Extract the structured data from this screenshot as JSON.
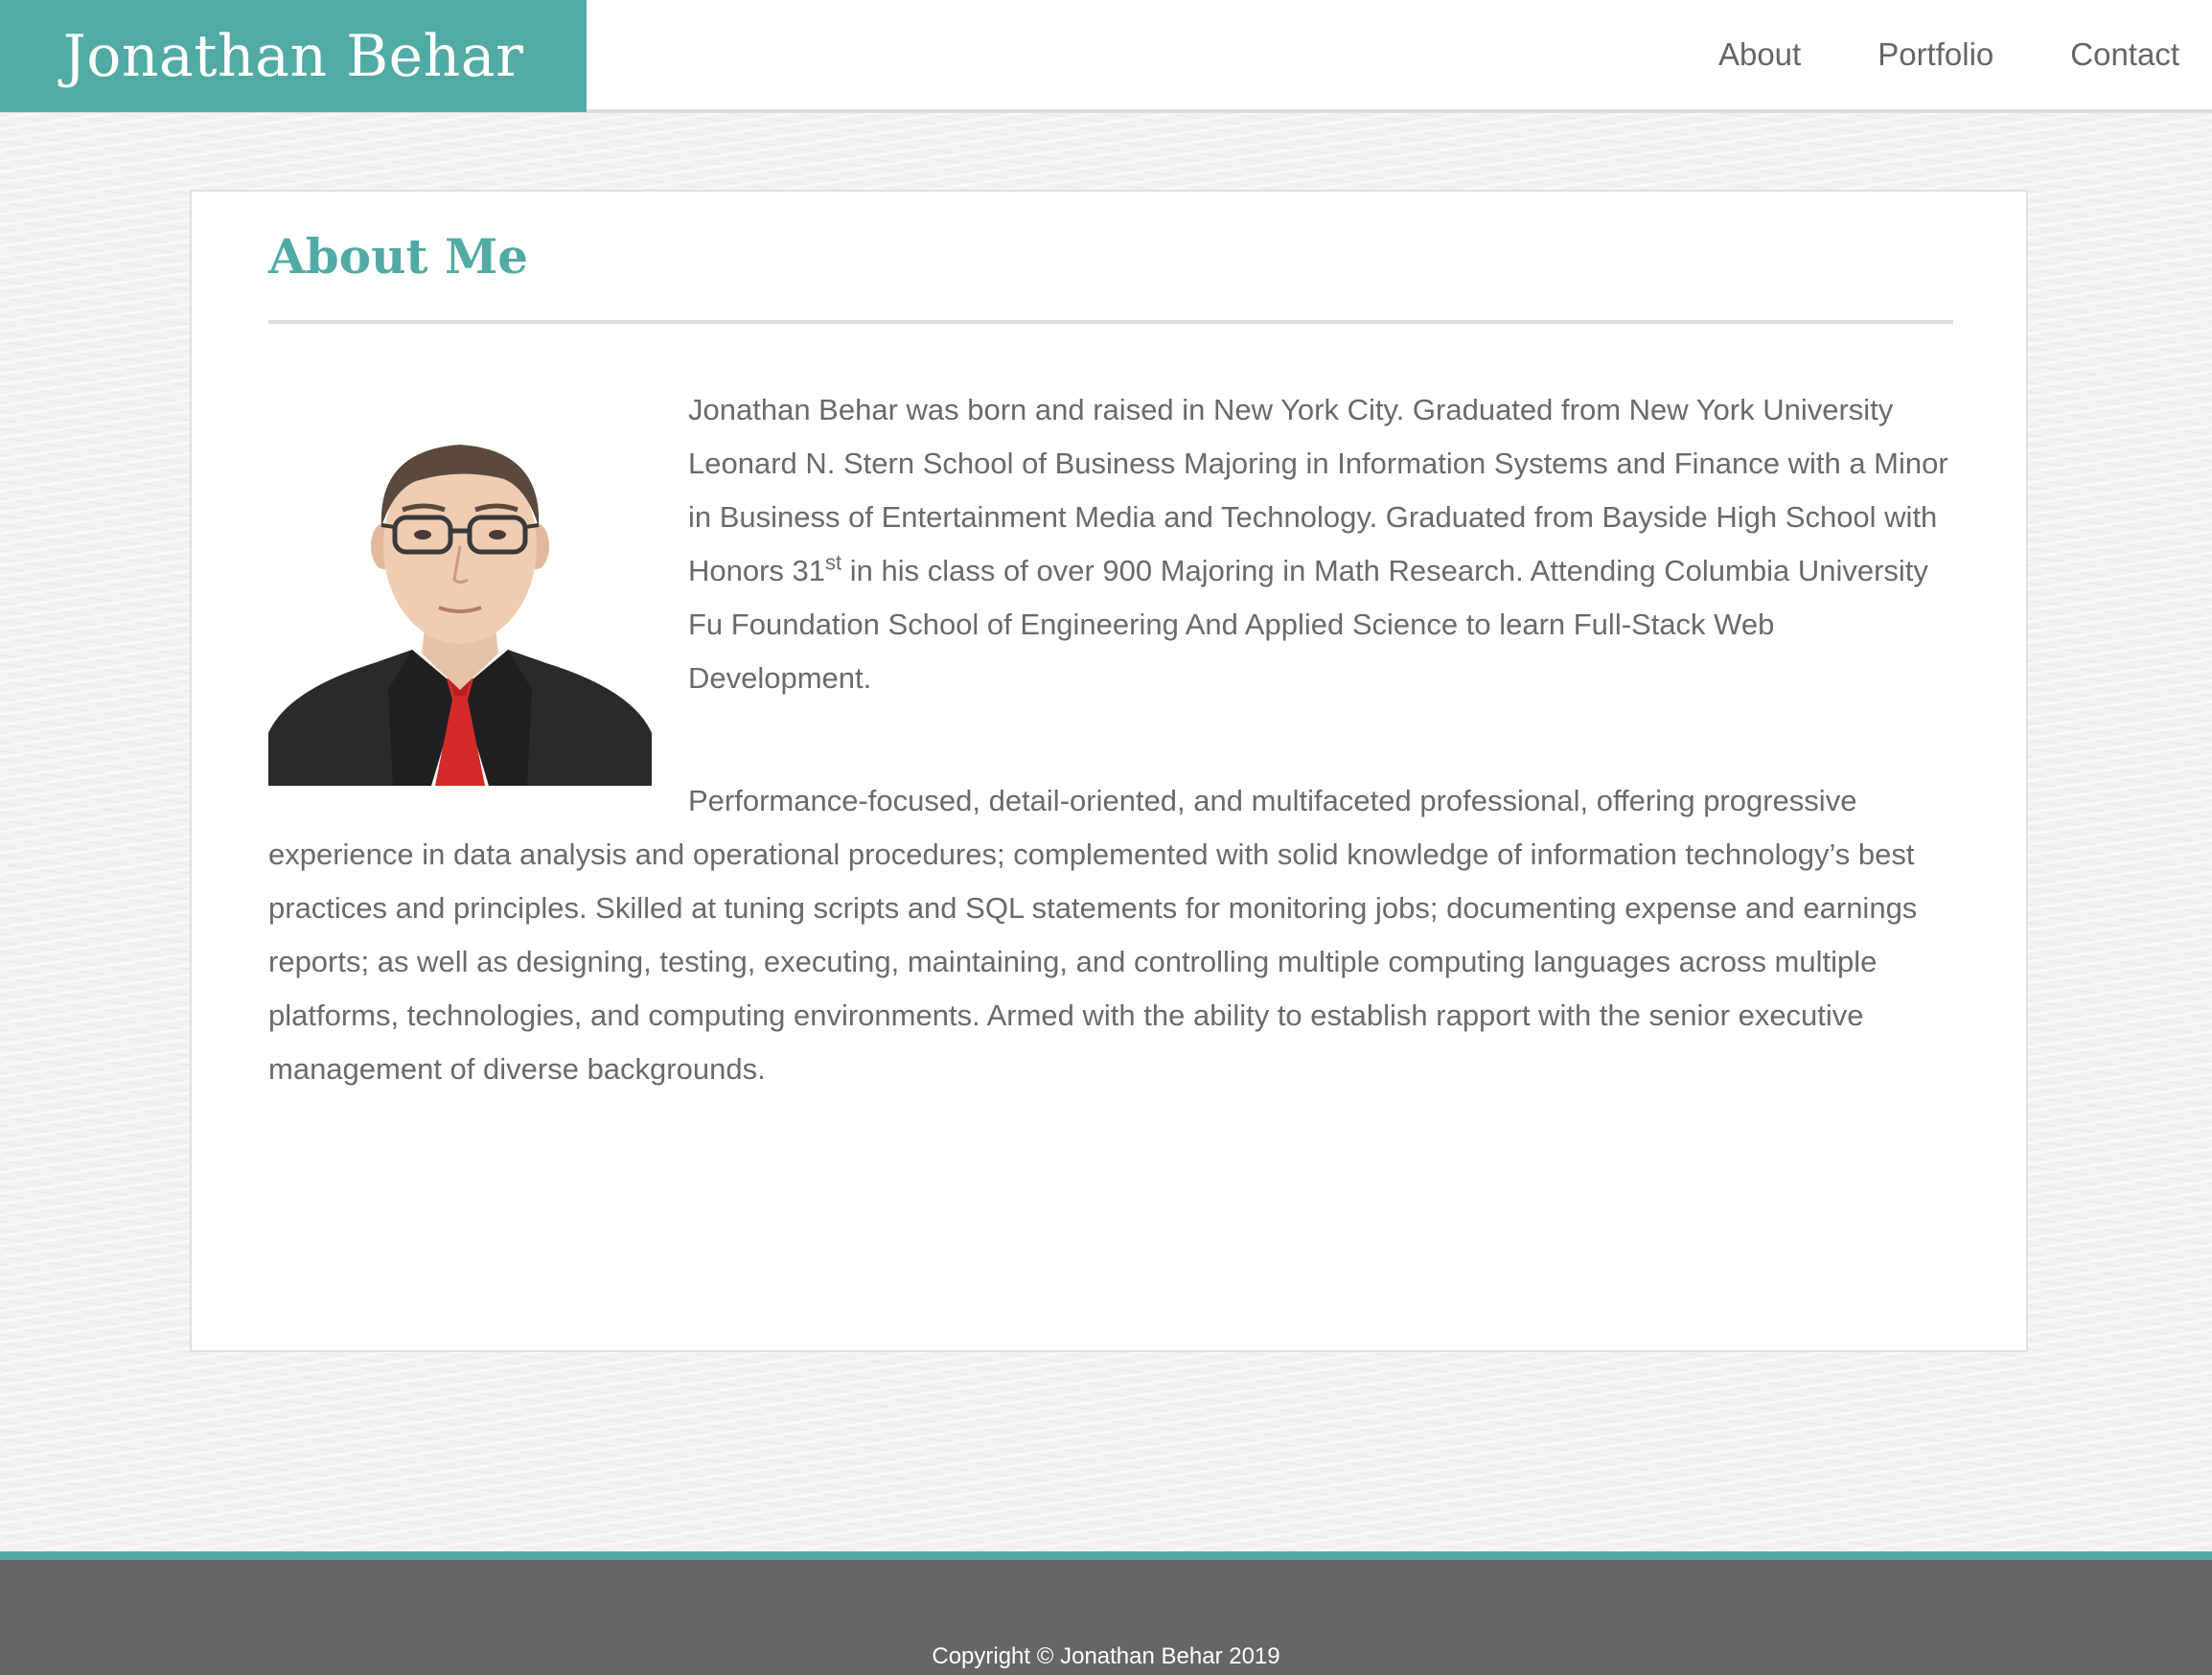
{
  "header": {
    "brand": "Jonathan Behar",
    "nav": [
      {
        "label": "About"
      },
      {
        "label": "Portfolio"
      },
      {
        "label": "Contact"
      }
    ]
  },
  "about": {
    "title": "About Me",
    "photo_alt": "Jonathan Behar",
    "p1_part1": "Jonathan Behar was born and raised in New York City. Graduated from New York University Leonard N. Stern School of Business Majoring in Information Systems and Finance with a Minor in Business of Entertainment Media and Technology. Graduated from Bayside High School with Honors 31",
    "p1_sup": "st",
    "p1_part2": " in his class of over 900 Majoring in Math Research. Attending Columbia University Fu Foundation School of Engineering And Applied Science to learn Full-Stack Web Development.",
    "p2": "Performance-focused, detail-oriented, and multifaceted professional, offering progressive experience in data analysis and operational procedures; complemented with solid knowledge of information technology’s best practices and principles. Skilled at tuning scripts and SQL statements for monitoring jobs; documenting expense and earnings reports; as well as designing, testing, executing, maintaining, and controlling multiple computing languages across multiple platforms, technologies, and computing environments. Armed with the ability to establish rapport with the senior executive management of diverse backgrounds."
  },
  "footer": {
    "copyright": "Copyright © Jonathan Behar 2019"
  },
  "colors": {
    "accent": "#51aba4",
    "text": "#6a6a6a",
    "footer_bg": "#666666"
  },
  "icons": {
    "portrait": "person-photo"
  }
}
